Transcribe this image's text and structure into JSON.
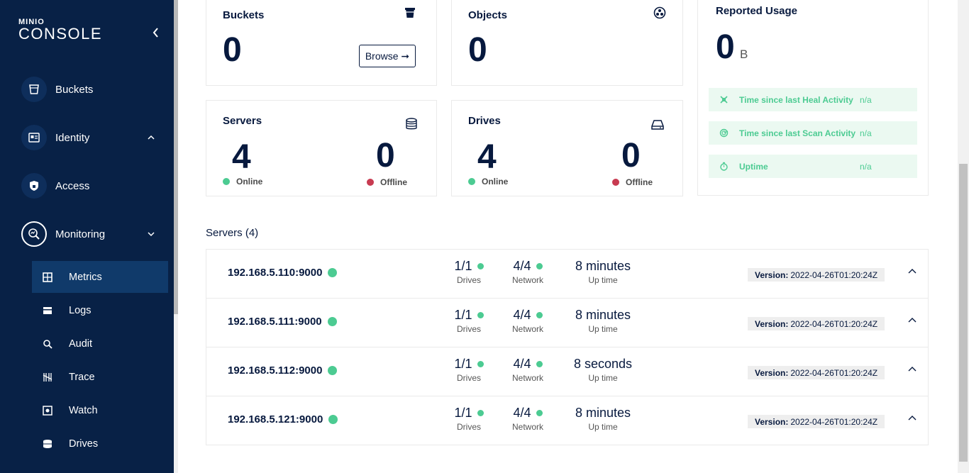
{
  "app": {
    "logo_small": "MINIO",
    "logo_main": "CONSOLE"
  },
  "sidebar": {
    "items": [
      {
        "label": "Buckets"
      },
      {
        "label": "Identity"
      },
      {
        "label": "Access"
      },
      {
        "label": "Monitoring"
      }
    ],
    "monitoring_sub": [
      {
        "label": "Metrics"
      },
      {
        "label": "Logs"
      },
      {
        "label": "Audit"
      },
      {
        "label": "Trace"
      },
      {
        "label": "Watch"
      },
      {
        "label": "Drives"
      }
    ]
  },
  "cards": {
    "buckets": {
      "title": "Buckets",
      "value": "0",
      "browse_label": "Browse ➞"
    },
    "objects": {
      "title": "Objects",
      "value": "0"
    },
    "servers": {
      "title": "Servers",
      "online": "4",
      "offline": "0",
      "online_label": "Online",
      "offline_label": "Offline"
    },
    "drives": {
      "title": "Drives",
      "online": "4",
      "offline": "0",
      "online_label": "Online",
      "offline_label": "Offline"
    },
    "usage": {
      "title": "Reported Usage",
      "value": "0",
      "unit": "B",
      "activities": [
        {
          "label": "Time since last Heal Activity",
          "value": "n/a"
        },
        {
          "label": "Time since last Scan Activity",
          "value": "n/a"
        },
        {
          "label": "Uptime",
          "value": "n/a"
        }
      ]
    }
  },
  "servers_section": {
    "heading": "Servers (4)",
    "rows": [
      {
        "name": "192.168.5.110:9000",
        "drives": "1/1",
        "network": "4/4",
        "uptime": "8 minutes",
        "version": "2022-04-26T01:20:24Z"
      },
      {
        "name": "192.168.5.111:9000",
        "drives": "1/1",
        "network": "4/4",
        "uptime": "8 minutes",
        "version": "2022-04-26T01:20:24Z"
      },
      {
        "name": "192.168.5.112:9000",
        "drives": "1/1",
        "network": "4/4",
        "uptime": "8 seconds",
        "version": "2022-04-26T01:20:24Z"
      },
      {
        "name": "192.168.5.121:9000",
        "drives": "1/1",
        "network": "4/4",
        "uptime": "8 minutes",
        "version": "2022-04-26T01:20:24Z"
      }
    ],
    "labels": {
      "drives": "Drives",
      "network": "Network",
      "uptime": "Up time",
      "version": "Version:"
    }
  },
  "colors": {
    "sidebar_bg": "#082146",
    "accent_green": "#4ccb92",
    "offline_red": "#c83b51",
    "text_dark": "#07193E"
  }
}
